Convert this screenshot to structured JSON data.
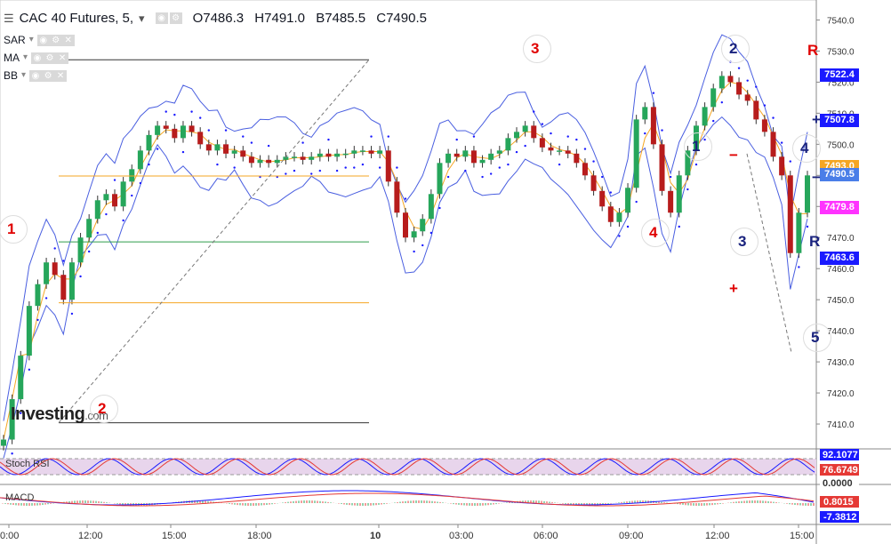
{
  "header": {
    "symbol": "CAC 40 Futures, 5,",
    "open": "O7486.3",
    "high": "H7491.0",
    "low": "B7485.5",
    "close": "C7490.5"
  },
  "indicators": [
    {
      "label": "SAR"
    },
    {
      "label": "MA"
    },
    {
      "label": "BB"
    }
  ],
  "logo": {
    "main": "Investing",
    "suffix": ".com"
  },
  "price_axis": {
    "ticks": [
      "7540.0",
      "7530.0",
      "7520.0",
      "7510.0",
      "7500.0",
      "7490.0",
      "7480.0",
      "7470.0",
      "7460.0",
      "7450.0",
      "7440.0",
      "7430.0",
      "7420.0",
      "7410.0"
    ],
    "tags": [
      {
        "value": "7522.4",
        "color": "#1a1aff"
      },
      {
        "value": "7507.8",
        "color": "#1a1aff"
      },
      {
        "value": "7493.0",
        "color": "#f5a623"
      },
      {
        "value": "7490.5",
        "color": "#4a7ee8"
      },
      {
        "value": "7479.8",
        "color": "#ff33ff"
      },
      {
        "value": "7463.6",
        "color": "#1a1aff"
      }
    ]
  },
  "time_axis": {
    "labels": [
      "0:00",
      "12:00",
      "15:00",
      "18:00",
      "10",
      "03:00",
      "06:00",
      "09:00",
      "12:00",
      "15:00"
    ]
  },
  "stoch_rsi": {
    "label": "Stoch RSI",
    "tags": [
      {
        "value": "92.1077",
        "color": "#1a1aff"
      },
      {
        "value": "76.6749",
        "color": "#e53935"
      },
      {
        "value": "0.0000",
        "color": "#ffffff"
      }
    ]
  },
  "macd": {
    "label": "MACD",
    "tags": [
      {
        "value": "0.8015",
        "color": "#e53935"
      },
      {
        "value": "-7.3812",
        "color": "#1a1aff"
      }
    ]
  },
  "annotations": [
    {
      "text": "1",
      "color": "#e00000"
    },
    {
      "text": "2",
      "color": "#e00000"
    },
    {
      "text": "3",
      "color": "#e00000"
    },
    {
      "text": "4",
      "color": "#e00000"
    },
    {
      "text": "1",
      "color": "#1a237e"
    },
    {
      "text": "2",
      "color": "#1a237e"
    },
    {
      "text": "3",
      "color": "#1a237e"
    },
    {
      "text": "4",
      "color": "#1a237e"
    },
    {
      "text": "5",
      "color": "#1a237e"
    },
    {
      "text": "R",
      "color": "#e00000"
    },
    {
      "text": "R",
      "color": "#1a237e"
    },
    {
      "text": "+",
      "color": "#e00000"
    },
    {
      "text": "−",
      "color": "#e00000"
    },
    {
      "text": "+",
      "color": "#1a237e"
    },
    {
      "text": "−",
      "color": "#1a237e"
    }
  ],
  "chart_data": {
    "type": "line",
    "title": "CAC 40 Futures, 5",
    "ylim": [
      7402,
      7545
    ],
    "series": [
      {
        "values": [
          7405,
          7418,
          7432,
          7448,
          7455,
          7462,
          7458,
          7450,
          7462,
          7470,
          7476,
          7482,
          7484,
          7480,
          7488,
          7492,
          7498,
          7503,
          7506,
          7505,
          7502,
          7506,
          7504,
          7500,
          7498,
          7500,
          7497,
          7498,
          7496,
          7494,
          7495,
          7494,
          7495,
          7496,
          7496,
          7495,
          7496,
          7497,
          7496,
          7497,
          7497,
          7498,
          7498,
          7497,
          7498,
          7488,
          7478,
          7470,
          7472,
          7476,
          7484,
          7494,
          7497,
          7496,
          7498,
          7494,
          7495,
          7497,
          7498,
          7502,
          7504,
          7506,
          7502,
          7499,
          7498,
          7498,
          7497,
          7494,
          7490,
          7485,
          7480,
          7475,
          7478,
          7486,
          7508,
          7512,
          7500,
          7485,
          7478,
          7490,
          7498,
          7506,
          7512,
          7518,
          7522,
          7520,
          7516,
          7514,
          7508,
          7504,
          7496,
          7490,
          7465,
          7478,
          7490
        ]
      }
    ],
    "levels": [
      7489.8,
      7468.6,
      7449.0,
      7410.4,
      7527.2
    ]
  }
}
